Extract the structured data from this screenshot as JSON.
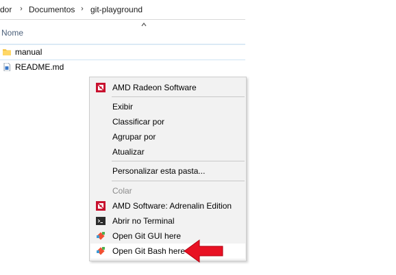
{
  "breadcrumb": {
    "items": [
      "dor",
      "Documentos",
      "git-playground"
    ],
    "separator": "›"
  },
  "columns": {
    "name_label": "Nome",
    "sort_icon": "chevron-up-icon"
  },
  "files": [
    {
      "name": "manual",
      "icon": "folder-icon"
    },
    {
      "name": "README.md",
      "icon": "markdown-file-icon"
    }
  ],
  "context_menu": {
    "items": [
      {
        "label": "AMD Radeon Software",
        "icon": "amd-icon",
        "disabled": false
      },
      {
        "label": "Exibir",
        "icon": "",
        "disabled": false
      },
      {
        "label": "Classificar por",
        "icon": "",
        "disabled": false
      },
      {
        "label": "Agrupar por",
        "icon": "",
        "disabled": false
      },
      {
        "label": "Atualizar",
        "icon": "",
        "disabled": false
      },
      {
        "label": "Personalizar esta pasta...",
        "icon": "",
        "disabled": false
      },
      {
        "label": "Colar",
        "icon": "",
        "disabled": true
      },
      {
        "label": "AMD Software: Adrenalin Edition",
        "icon": "amd-icon",
        "disabled": false
      },
      {
        "label": "Abrir no Terminal",
        "icon": "terminal-icon",
        "disabled": false
      },
      {
        "label": "Open Git GUI here",
        "icon": "git-icon",
        "disabled": false
      },
      {
        "label": "Open Git Bash here",
        "icon": "git-icon",
        "disabled": false,
        "highlighted": true
      }
    ]
  },
  "annotation": {
    "icon": "red-arrow-icon",
    "color": "#e81123"
  },
  "colors": {
    "amd_red": "#c8102e",
    "git_orange": "#f05133",
    "menu_bg": "#f2f2f2",
    "header_text": "#4c607a",
    "folder_yellow": "#f5c342"
  }
}
